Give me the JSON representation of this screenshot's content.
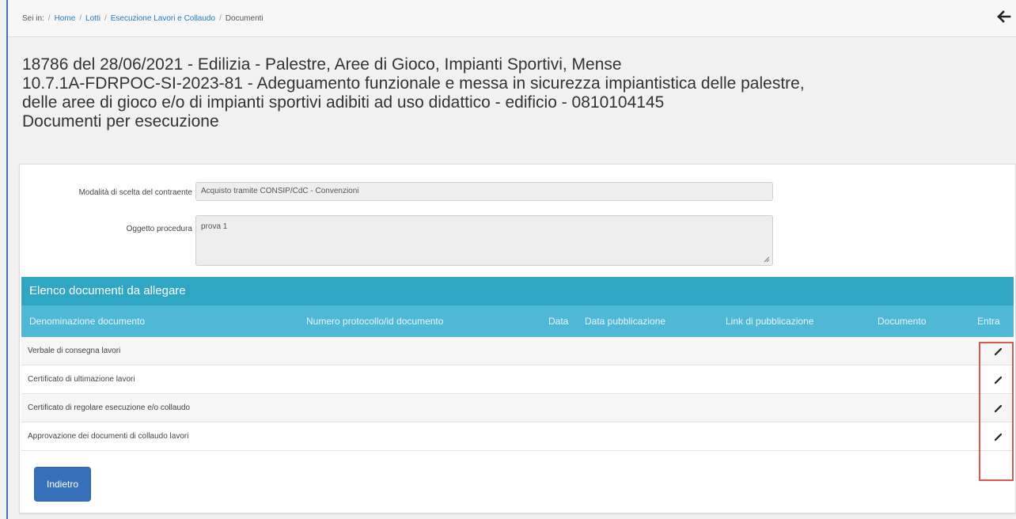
{
  "breadcrumb": {
    "prefix": "Sei in:",
    "items": [
      "Home",
      "Lotti",
      "Esecuzione Lavori e Collaudo",
      "Documenti"
    ]
  },
  "title": {
    "line1": "18786 del 28/06/2021 - Edilizia - Palestre, Aree di Gioco, Impianti Sportivi, Mense",
    "line2": "10.7.1A-FDRPOC-SI-2023-81 - Adeguamento funzionale e messa in sicurezza impiantistica delle palestre,",
    "line3": "delle aree di gioco e/o di impianti sportivi adibiti ad uso didattico - edificio - 0810104145",
    "line4": "Documenti per esecuzione"
  },
  "form": {
    "modalita_label": "Modalità di scelta del contraente",
    "modalita_value": "Acquisto tramite CONSIP/CdC - Convenzioni",
    "oggetto_label": "Oggetto procedura",
    "oggetto_value": "prova 1"
  },
  "table": {
    "section_title": "Elenco documenti da allegare",
    "columns": [
      "Denominazione documento",
      "Numero protocollo/id documento",
      "Data",
      "Data pubblicazione",
      "Link di pubblicazione",
      "Documento",
      "Entra"
    ],
    "rows": [
      "Verbale di consegna lavori",
      "Certificato di ultimazione lavori",
      "Certificato di regolare esecuzione e/o collaudo",
      "Approvazione dei documenti di collaudo lavori"
    ]
  },
  "buttons": {
    "back_label": "Indietro"
  },
  "colors": {
    "section_header": "#2fa7c4",
    "column_header": "#4fb8d6",
    "primary_button": "#3570b8",
    "highlight_border": "#e05555"
  },
  "icons": {
    "back": "arrow-left-icon",
    "edit": "pencil-icon"
  }
}
